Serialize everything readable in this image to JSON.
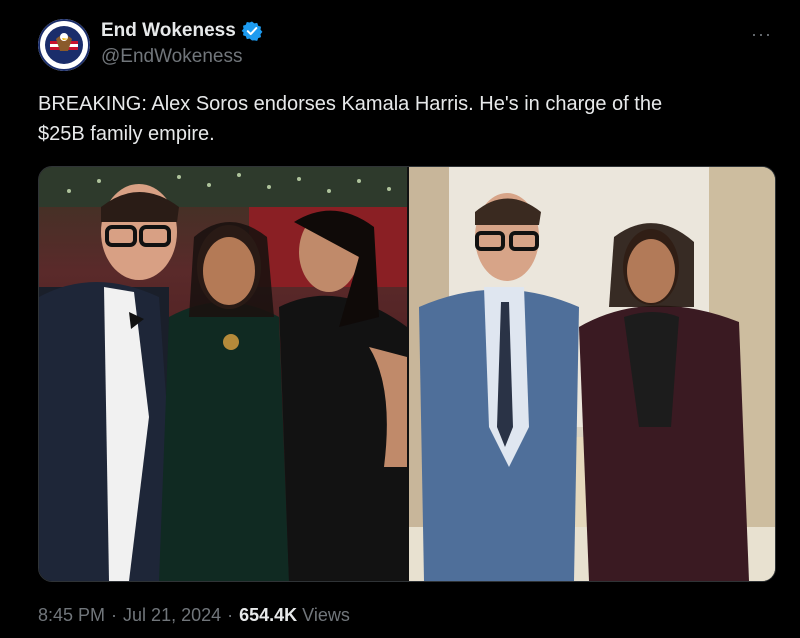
{
  "author": {
    "display_name": "End Wokeness",
    "handle": "@EndWokeness",
    "verified": true,
    "avatar_text": "SUPPORT THE DAMN THING",
    "avatar_colors": {
      "ring": "#1a2d6b",
      "red": "#c8102e",
      "white": "#ffffff"
    }
  },
  "tweet": {
    "line1": "BREAKING: Alex Soros endorses Kamala Harris. He's in charge of the",
    "line2": "$25B family empire."
  },
  "media": {
    "left_photo_icon": "event-photo-icon",
    "right_photo_icon": "office-photo-icon"
  },
  "meta": {
    "time": "8:45 PM",
    "date": "Jul 21, 2024",
    "views_count": "654.4K",
    "views_label": "Views",
    "separator": "·"
  },
  "menu": {
    "more_label": "···"
  },
  "colors": {
    "background": "#000000",
    "text": "#e7e9ea",
    "muted": "#71767b",
    "verified": "#1d9bf0"
  }
}
